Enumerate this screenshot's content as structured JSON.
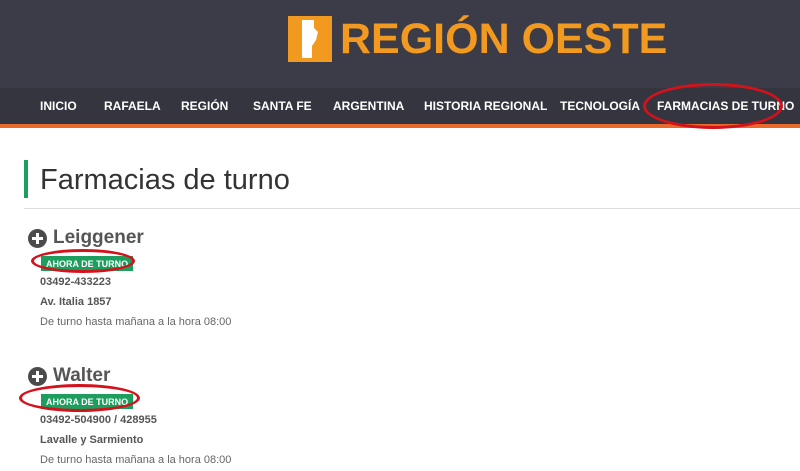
{
  "header": {
    "logo_text": "REGIÓN OESTE",
    "logo_icon": "santa-fe-province-icon",
    "colors": {
      "brand": "#f29a1f",
      "header_bg": "#3b3c48",
      "nav_bg": "#34353f",
      "nav_accent": "#e8692a",
      "badge": "#1e9e5e",
      "highlight": "#d3121b"
    }
  },
  "nav": {
    "items": [
      {
        "label": "INICIO"
      },
      {
        "label": "RAFAELA"
      },
      {
        "label": "REGIÓN"
      },
      {
        "label": "SANTA FE"
      },
      {
        "label": "ARGENTINA"
      },
      {
        "label": "HISTORIA REGIONAL"
      },
      {
        "label": "TECNOLOGÍA"
      },
      {
        "label": "FARMACIAS DE TURNO"
      }
    ]
  },
  "main": {
    "title": "Farmacias de turno",
    "pharmacies": [
      {
        "name": "Leiggener",
        "badge": "AHORA DE TURNO",
        "phone": "03492-433223",
        "address": "Av. Italia 1857",
        "hours": "De turno hasta mañana a la hora 08:00"
      },
      {
        "name": "Walter",
        "badge": "AHORA DE TURNO",
        "phone": "03492-504900 / 428955",
        "address": "Lavalle y Sarmiento",
        "hours": "De turno hasta mañana a la hora 08:00"
      }
    ]
  }
}
